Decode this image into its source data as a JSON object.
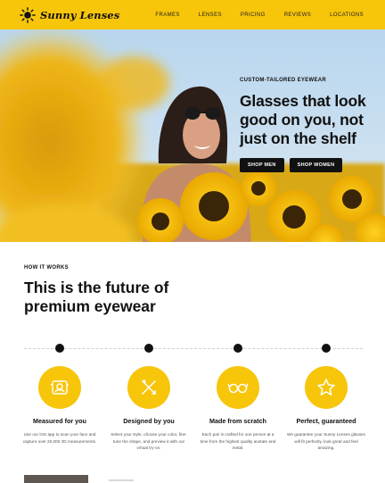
{
  "brand": {
    "name": "Sunny Lenses",
    "color": "#f7c50a",
    "icon": "sun-icon"
  },
  "nav": {
    "items": [
      "FRAMES",
      "LENSES",
      "PRICING",
      "REVIEWS",
      "LOCATIONS"
    ]
  },
  "hero": {
    "eyebrow": "CUSTOM-TAILORED EYEWEAR",
    "title": "Glasses that look good on you, not just on the shelf",
    "buttons": [
      "SHOP MEN",
      "SHOP WOMEN"
    ],
    "image": "woman-in-sunflower-field-photo"
  },
  "how": {
    "label": "HOW IT WORKS",
    "title": "This is the future of premium eyewear",
    "steps": [
      {
        "icon": "measure-icon",
        "title": "Measured for you",
        "desc": "Use our iOS app to scan your face and capture over 20,000 3D measurements."
      },
      {
        "icon": "design-tools-icon",
        "title": "Designed by you",
        "desc": "Select your style, choose your color, fine-tune the shape, and preview it with our virtual try-on."
      },
      {
        "icon": "glasses-icon",
        "title": "Made from scratch",
        "desc": "Each pair is crafted for one person at a time from the highest quality acetate and metal."
      },
      {
        "icon": "star-icon",
        "title": "Perfect, guaranteed",
        "desc": "We guarantee your Sunny Lenses glasses will fit perfectly, look great and feel amazing."
      }
    ]
  }
}
